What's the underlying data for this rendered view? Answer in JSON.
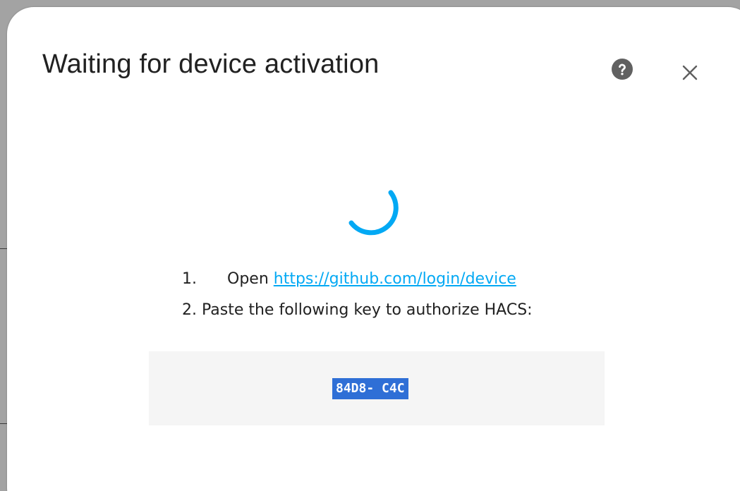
{
  "dialog": {
    "title": "Waiting for device activation",
    "help_icon": "help-circle-icon",
    "close_icon": "close-icon"
  },
  "progress": {
    "icon": "loading-spinner-icon",
    "color": "#03a9f4"
  },
  "instructions": {
    "step1_number": "1.",
    "step1_text": "Open",
    "step1_link": "https://github.com/login/device",
    "step2_text": "2. Paste the following key to authorize HACS:"
  },
  "device_code": {
    "value": "84D8- C4C",
    "highlight_color": "#2f6fd6"
  }
}
